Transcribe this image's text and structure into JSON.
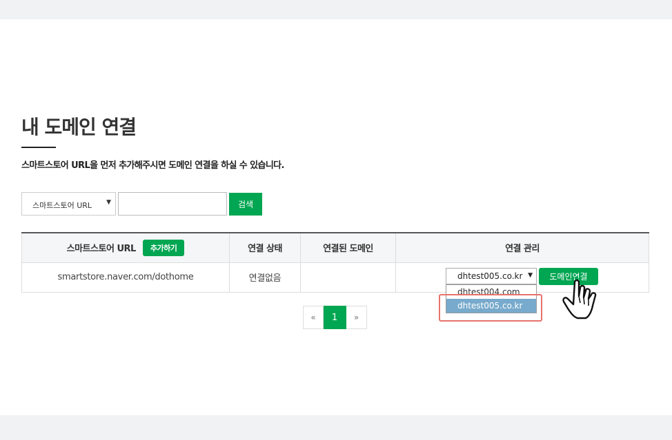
{
  "page": {
    "title": "내 도메인 연결",
    "description": "스마트스토어 URL을 먼저 추가해주시면 도메인 연결을 하실 수 있습니다."
  },
  "search": {
    "select_value": "스마트스토어 URL",
    "input_value": "",
    "button_label": "검색"
  },
  "table": {
    "headers": {
      "store_url": "스마트스토어 URL",
      "add_button": "추가하기",
      "status": "연결 상태",
      "connected_domain": "연결된 도메인",
      "manage": "연결 관리"
    },
    "rows": [
      {
        "store_url": "smartstore.naver.com/dothome",
        "status": "연결없음",
        "connected_domain": "",
        "domain_select_value": "dhtest005.co.kr",
        "domain_options": [
          "dhtest004.com",
          "dhtest005.co.kr"
        ],
        "selected_option": "dhtest005.co.kr",
        "connect_button": "도메인연결"
      }
    ]
  },
  "pagination": {
    "prev": "«",
    "current": "1",
    "next": "»"
  },
  "colors": {
    "accent_green": "#00a651",
    "highlight_red": "#e7726b",
    "option_selected": "#77aacc"
  },
  "icons": {
    "dropdown": "caret-down-icon",
    "cursor": "hand-pointer-icon"
  }
}
